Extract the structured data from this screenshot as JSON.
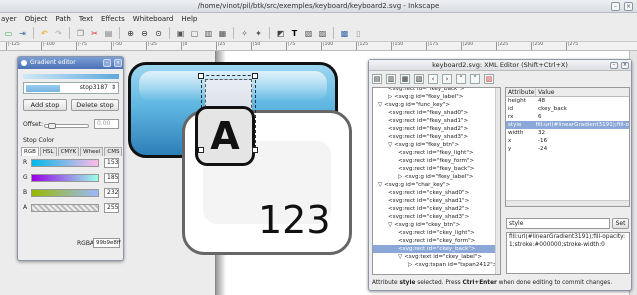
{
  "window": {
    "title": "/home/vinot/pil/btk/src/exemples/keyboard/keyboard2.svg - Inkscape",
    "min": "–",
    "close": "×"
  },
  "menu": [
    "ayer",
    "Object",
    "Path",
    "Text",
    "Effects",
    "Whiteboard",
    "Help"
  ],
  "toolbar_icons": [
    "open-icon",
    "export-icon",
    "undo-icon",
    "redo-icon",
    "copy-icon",
    "cut-icon",
    "paste-icon",
    "zoom-in-icon",
    "zoom-out-icon",
    "zoom-fit-icon",
    "group-icon",
    "ungroup-icon",
    "align-icon",
    "distribute-icon",
    "node-icon",
    "text-icon",
    "fill-icon",
    "xml-icon",
    "layers-icon"
  ],
  "ruler": [
    "|-125",
    "|-100",
    "|-75",
    "|-50",
    "|-25",
    "|0",
    "|25",
    "|50",
    "|75",
    "|100",
    "|125",
    "|150",
    "|175",
    "|200",
    "|225",
    "|250",
    "|275"
  ],
  "canvas": {
    "key_letter": "A",
    "number_text": "123"
  },
  "gradient_editor": {
    "title": "Gradient editor",
    "stop_name": "stop3187",
    "add_stop": "Add stop",
    "delete_stop": "Delete stop",
    "offset_label": "Offset:",
    "offset_value": "0.00",
    "stop_color_label": "Stop Color",
    "tabs": [
      "RGB",
      "HSL",
      "CMYK",
      "Wheel",
      "CMS"
    ],
    "channels": [
      {
        "label": "R",
        "value": "153"
      },
      {
        "label": "G",
        "value": "185"
      },
      {
        "label": "B",
        "value": "232"
      },
      {
        "label": "A",
        "value": "255"
      }
    ],
    "rgba_label": "RGBA:",
    "rgba_value": "99b9e8ff"
  },
  "xml_editor": {
    "title": "keyboard2.svg: XML Editor (Shift+Ctrl+X)",
    "tree": [
      "<svg:rect id=\"fkey_back\">",
      "▷ <svg:g id=\"fkey_label\">",
      "▽ <svg:g id=\"func_key\">",
      "<svg:rect id=\"fkey_shad0\">",
      "<svg:rect id=\"fkey_shad1\">",
      "<svg:rect id=\"fkey_shad2\">",
      "<svg:rect id=\"fkey_shad3\">",
      "▽ <svg:g id=\"fkey_btn\">",
      "<svg:rect id=\"fkey_light\">",
      "<svg:rect id=\"fkey_form\">",
      "<svg:rect id=\"fkey_back\">",
      "▷ <svg:g id=\"fkey_label\">",
      "▽ <svg:g id=\"char_key\">",
      "<svg:rect id=\"ckey_shad0\">",
      "<svg:rect id=\"ckey_shad1\">",
      "<svg:rect id=\"ckey_shad2\">",
      "<svg:rect id=\"ckey_shad3\">",
      "▽ <svg:g id=\"ckey_btn\">",
      "<svg:rect id=\"ckey_light\">",
      "<svg:rect id=\"ckey_form\">",
      "<svg:rect id=\"ckey_back\">",
      "▽ <svg:text id=\"ckey_label\">",
      "▷ <svg:tspan id=\"tspan2412\">"
    ],
    "tree_indent": [
      3,
      3,
      1,
      3,
      3,
      3,
      3,
      3,
      5,
      5,
      5,
      5,
      1,
      3,
      3,
      3,
      3,
      3,
      5,
      5,
      5,
      5,
      7
    ],
    "tree_selected": 20,
    "attr_header": {
      "name": "Attribute",
      "value": "Value"
    },
    "attrs": [
      {
        "name": "height",
        "value": "48"
      },
      {
        "name": "id",
        "value": "ckey_back"
      },
      {
        "name": "rx",
        "value": "6"
      },
      {
        "name": "style",
        "value": "fill:url(#linearGradient3191);fill-o"
      },
      {
        "name": "width",
        "value": "32"
      },
      {
        "name": "x",
        "value": "-16"
      },
      {
        "name": "y",
        "value": "-24"
      }
    ],
    "attr_selected": 3,
    "attr_name_field": "style",
    "set_button": "Set",
    "attr_value_text": "fill:url(#linearGradient3191);fill-opacity:1;stroke:#000000;stroke-width:0",
    "status_pre": "Attribute ",
    "status_attr": "style",
    "status_mid": " selected. Press ",
    "status_key": "Ctrl+Enter",
    "status_post": " when done editing to commit changes."
  }
}
